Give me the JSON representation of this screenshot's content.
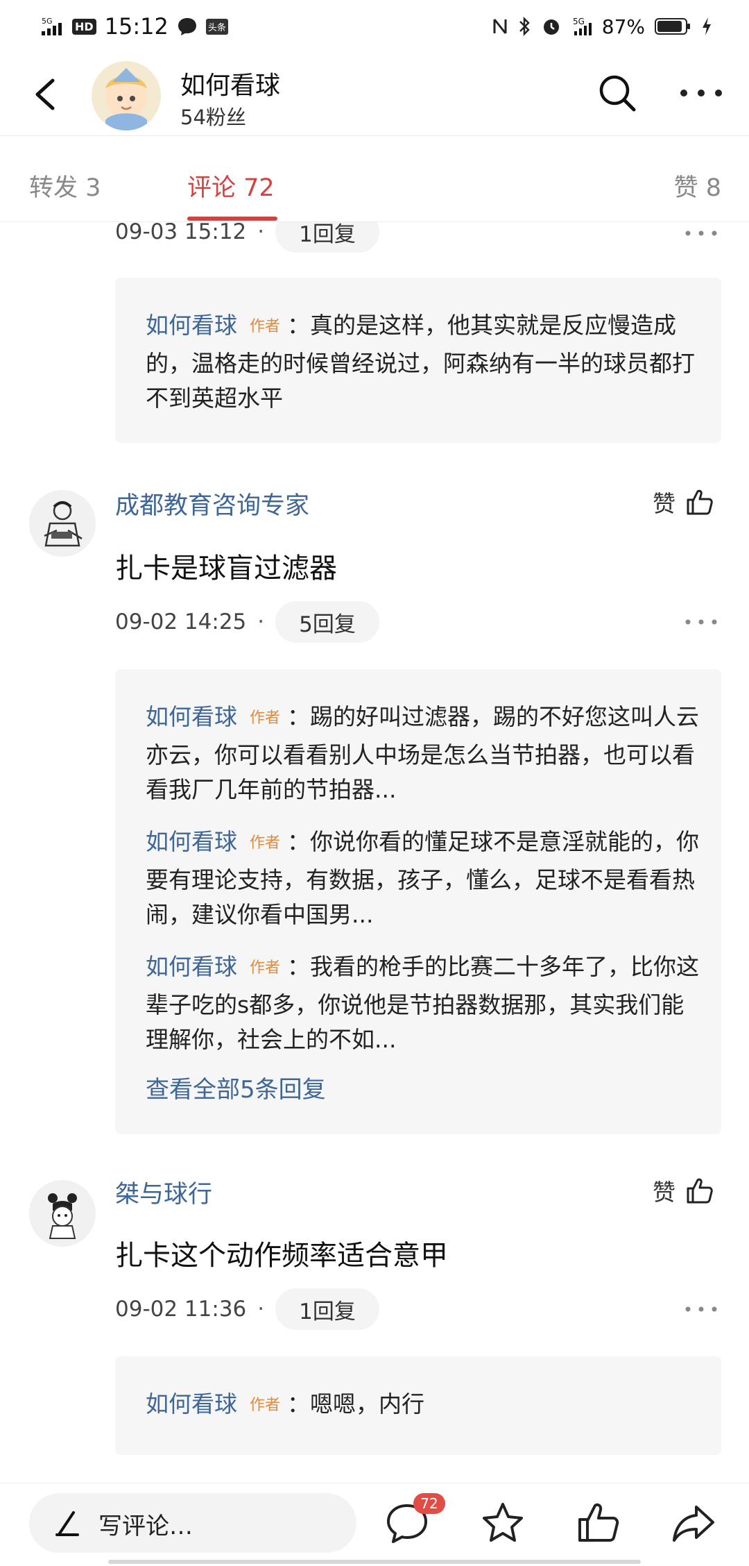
{
  "status_bar": {
    "time": "15:12",
    "signal": "5G",
    "hd": "HD",
    "app_tag": "头条",
    "network": "5G",
    "battery_percent": "87%"
  },
  "header": {
    "title": "如何看球",
    "subtitle": "54粉丝"
  },
  "tabs": [
    {
      "label": "转发 3"
    },
    {
      "label": "评论 72"
    },
    {
      "label": "赞 8"
    }
  ],
  "comments": [
    {
      "time": "09-03 15:12",
      "replies_label": "1回复",
      "replies": [
        {
          "name": "如何看球",
          "tag": "作者",
          "text": "：真的是这样，他其实就是反应慢造成的，温格走的时候曾经说过，阿森纳有一半的球员都打不到英超水平"
        }
      ]
    },
    {
      "name": "成都教育咨询专家",
      "like_label": "赞",
      "text": "扎卡是球盲过滤器",
      "time": "09-02 14:25",
      "replies_label": "5回复",
      "replies": [
        {
          "name": "如何看球",
          "tag": "作者",
          "text": "：踢的好叫过滤器，踢的不好您这叫人云亦云，你可以看看别人中场是怎么当节拍器，也可以看看我厂几年前的节拍器..."
        },
        {
          "name": "如何看球",
          "tag": "作者",
          "text": "：你说你看的懂足球不是意淫就能的，你要有理论支持，有数据，孩子，懂么，足球不是看看热闹，建议你看中国男..."
        },
        {
          "name": "如何看球",
          "tag": "作者",
          "text": "：我看的枪手的比赛二十多年了，比你这辈子吃的s都多，你说他是节拍器数据那，其实我们能理解你，社会上的不如..."
        }
      ],
      "see_all": "查看全部5条回复"
    },
    {
      "name": "桀与球行",
      "like_label": "赞",
      "text": "扎卡这个动作频率适合意甲",
      "time": "09-02 11:36",
      "replies_label": "1回复",
      "replies": [
        {
          "name": "如何看球",
          "tag": "作者",
          "text": "：嗯嗯，内行"
        }
      ]
    }
  ],
  "bottom_bar": {
    "compose_placeholder": "写评论…",
    "comment_count_badge": "72"
  },
  "colors": {
    "accent_red": "#d7403d",
    "link_blue": "#3e6699",
    "author_tag_orange": "#e38a3a"
  }
}
